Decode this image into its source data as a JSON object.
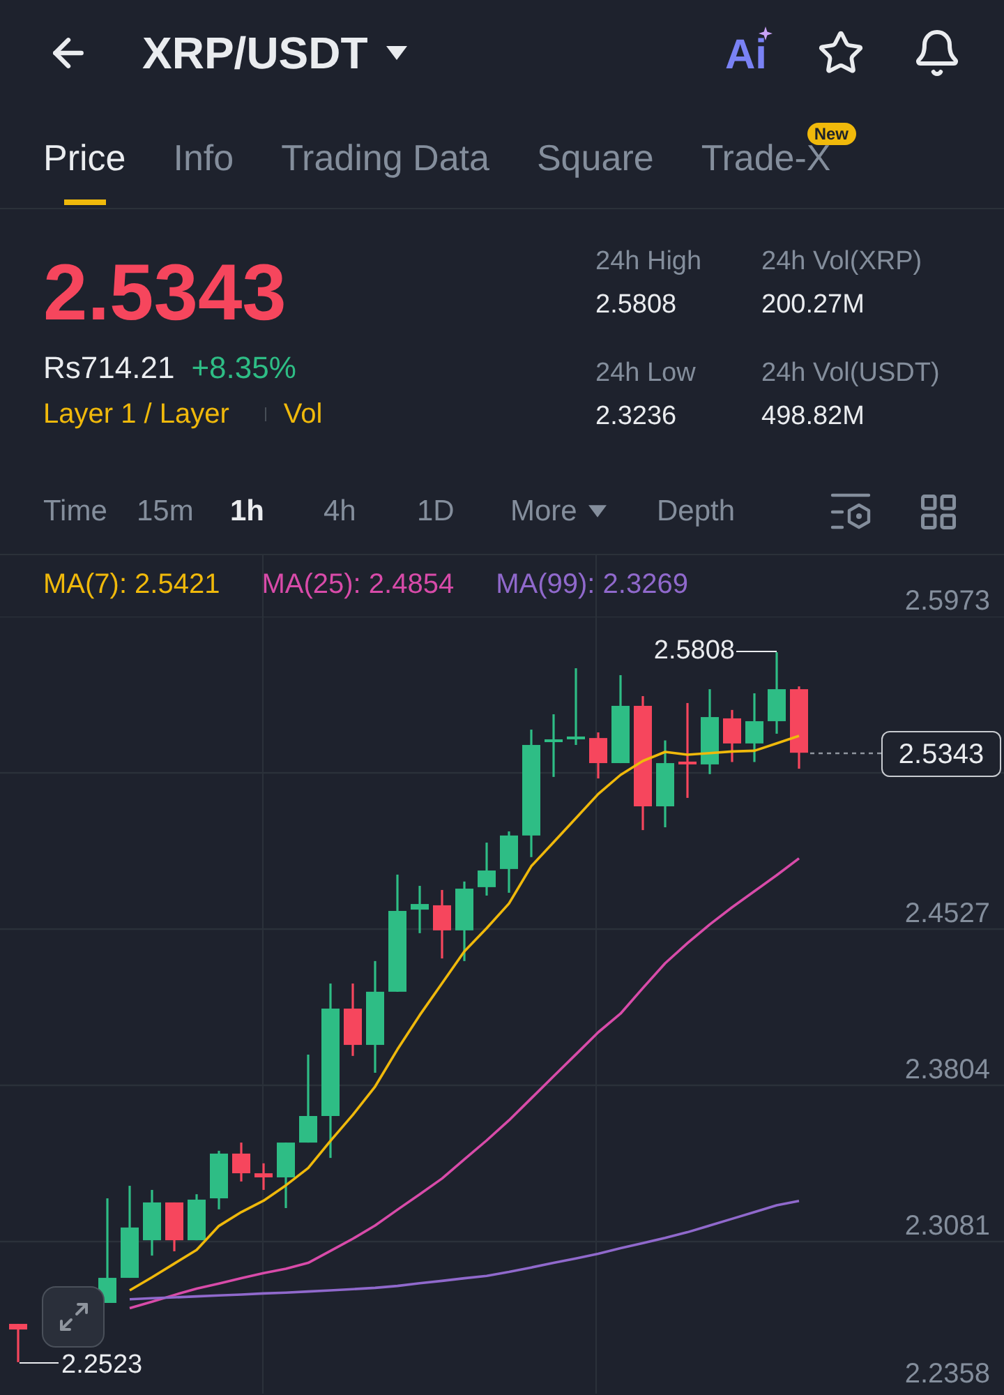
{
  "header": {
    "title": "XRP/USDT",
    "ai_button": "Ai"
  },
  "tabs": [
    {
      "label": "Price",
      "selected": true
    },
    {
      "label": "Info",
      "selected": false
    },
    {
      "label": "Trading Data",
      "selected": false
    },
    {
      "label": "Square",
      "selected": false
    },
    {
      "label": "Trade-X",
      "selected": false,
      "badge": "New"
    }
  ],
  "ticker": {
    "price": "2.5343",
    "fiat_price": "Rs714.21",
    "change": "+8.35%",
    "tags": [
      "Layer 1 / Layer",
      "Vol"
    ],
    "stats": [
      {
        "label": "24h High",
        "value": "2.5808"
      },
      {
        "label": "24h Vol(XRP)",
        "value": "200.27M"
      },
      {
        "label": "24h Low",
        "value": "2.3236"
      },
      {
        "label": "24h Vol(USDT)",
        "value": "498.82M"
      }
    ]
  },
  "intervals": [
    {
      "label": "Time",
      "selected": false,
      "dropdown": false
    },
    {
      "label": "15m",
      "selected": false,
      "dropdown": false
    },
    {
      "label": "1h",
      "selected": true,
      "dropdown": false
    },
    {
      "label": "4h",
      "selected": false,
      "dropdown": false
    },
    {
      "label": "1D",
      "selected": false,
      "dropdown": false
    },
    {
      "label": "More",
      "selected": false,
      "dropdown": true
    },
    {
      "label": "Depth",
      "selected": false,
      "dropdown": false
    }
  ],
  "chart": {
    "candles": {
      "chart_data": {
        "type": "candlestick",
        "grid": true,
        "ohlc": [
          null,
          [
            2.27,
            2.27,
            2.2523,
            2.2674
          ],
          null,
          null,
          null,
          [
            2.2797,
            2.3281,
            2.2797,
            2.2913
          ],
          [
            2.2913,
            2.3339,
            2.2913,
            2.3146
          ],
          [
            2.3087,
            2.332,
            2.3016,
            2.3262
          ],
          [
            2.3262,
            2.3262,
            2.3036,
            2.3087
          ],
          [
            2.3087,
            2.33,
            2.3087,
            2.3275
          ],
          [
            2.3281,
            2.3501,
            2.323,
            2.3488
          ],
          [
            2.3488,
            2.3539,
            2.3359,
            2.3397
          ],
          [
            2.3397,
            2.3443,
            2.332,
            2.3378
          ],
          [
            2.3378,
            2.3539,
            2.3236,
            2.3539
          ],
          [
            2.3539,
            2.3946,
            2.3539,
            2.3662
          ],
          [
            2.3662,
            2.4275,
            2.3468,
            2.4159
          ],
          [
            2.4159,
            2.4275,
            2.394,
            2.3991
          ],
          [
            2.3991,
            2.4379,
            2.3862,
            2.4237
          ],
          [
            2.4237,
            2.4779,
            2.4237,
            2.4611
          ],
          [
            2.4617,
            2.4727,
            2.4508,
            2.4643
          ],
          [
            2.4637,
            2.4708,
            2.4391,
            2.4521
          ],
          [
            2.4521,
            2.4747,
            2.4379,
            2.4714
          ],
          [
            2.4721,
            2.4927,
            2.4682,
            2.4798
          ],
          [
            2.4805,
            2.4979,
            2.4695,
            2.496
          ],
          [
            2.496,
            2.545,
            2.486,
            2.5379
          ],
          [
            2.5392,
            2.5521,
            2.5231,
            2.5405
          ],
          [
            2.5405,
            2.5734,
            2.5379,
            2.5418
          ],
          [
            2.5411,
            2.5437,
            2.5224,
            2.5295
          ],
          [
            2.5295,
            2.5702,
            2.5295,
            2.556
          ],
          [
            2.556,
            2.5605,
            2.4985,
            2.5095
          ],
          [
            2.5095,
            2.54,
            2.4998,
            2.5295
          ],
          [
            2.5302,
            2.5573,
            2.5134,
            2.5289
          ],
          [
            2.5289,
            2.5637,
            2.5244,
            2.5508
          ],
          [
            2.5502,
            2.5541,
            2.53,
            2.5386
          ],
          [
            2.5386,
            2.5618,
            2.53,
            2.5489
          ],
          [
            2.5489,
            2.5808,
            2.5431,
            2.5637
          ],
          [
            2.5637,
            2.565,
            2.5269,
            2.5343
          ]
        ],
        "ylim": [
          2.2358,
          2.5973
        ],
        "yticks": [
          {
            "value": 2.5973,
            "label": "2.5973"
          },
          {
            "value": 2.4527,
            "label": "2.4527"
          },
          {
            "value": 2.3804,
            "label": "2.3804"
          },
          {
            "value": 2.3081,
            "label": "2.3081"
          },
          {
            "value": 2.2358,
            "label": "2.2358"
          }
        ]
      }
    },
    "moving_averages": {
      "chart_data": {
        "type": "line",
        "grid": true,
        "series": [
          {
            "name": "MA(7): 2.5421",
            "color": "#f0b90b",
            "values": [
              null,
              null,
              null,
              null,
              null,
              null,
              2.2855,
              2.2916,
              2.2979,
              2.3042,
              2.3153,
              2.3217,
              2.327,
              2.3341,
              2.3421,
              2.3547,
              2.3667,
              2.3798,
              2.397,
              2.4129,
              2.4276,
              2.4424,
              2.4531,
              2.4645,
              2.4818,
              2.4929,
              2.504,
              2.5152,
              2.524,
              2.5305,
              2.5347,
              2.5334,
              2.5341,
              2.5349,
              2.5352,
              2.5386,
              2.5421
            ]
          },
          {
            "name": "MA(25): 2.4854",
            "color": "#d84ba9",
            "values": [
              null,
              null,
              null,
              null,
              null,
              null,
              2.2773,
              2.2803,
              2.2834,
              2.2863,
              2.2887,
              2.2912,
              2.2935,
              2.2955,
              2.2982,
              2.3038,
              2.3094,
              2.3155,
              2.3228,
              2.33,
              2.3373,
              2.3461,
              2.3549,
              2.3642,
              2.3744,
              2.3846,
              2.3947,
              2.4049,
              2.4136,
              2.4254,
              2.4369,
              2.4462,
              2.4548,
              2.4628,
              2.4702,
              2.4776,
              2.4854
            ]
          },
          {
            "name": "MA(99): 2.3269",
            "color": "#9069cc",
            "values": [
              null,
              null,
              null,
              null,
              null,
              null,
              2.2814,
              2.2819,
              2.2823,
              2.2827,
              2.2832,
              2.2836,
              2.2841,
              2.2845,
              2.285,
              2.2855,
              2.2861,
              2.2867,
              2.2876,
              2.2888,
              2.2899,
              2.2911,
              2.2922,
              2.294,
              2.2961,
              2.2982,
              2.3003,
              2.3025,
              2.305,
              2.3074,
              2.3098,
              2.3124,
              2.3155,
              2.3186,
              2.3217,
              2.3249,
              2.3269
            ]
          }
        ],
        "ylim": [
          2.2358,
          2.5973
        ]
      }
    },
    "last_price": "2.5343",
    "high_marker": "2.5808",
    "low_marker": "2.2523"
  }
}
